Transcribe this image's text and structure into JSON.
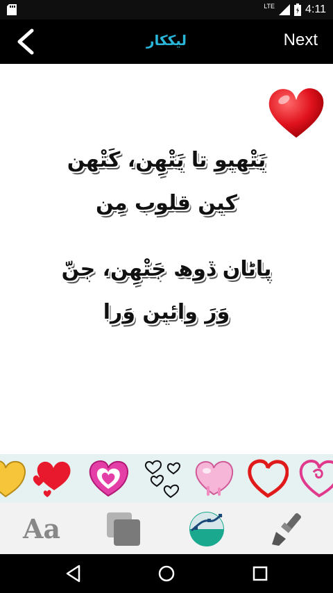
{
  "status": {
    "time": "4:11",
    "network": "LTE"
  },
  "appbar": {
    "title": "ليككار",
    "next_label": "Next"
  },
  "poem": {
    "line1": "يَتْهيو تا يَتْهِن، كَتْهن",
    "line2": "كين قلوب مِن",
    "line3": "پاڻان ڏوھ جَتْهِن، جنّ",
    "line4": "وَرَ وائين وَرا"
  },
  "stickers": [
    "yellow-heart",
    "red-hearts",
    "pink-heart",
    "outline-hearts",
    "pink-drip-heart",
    "red-outline-heart",
    "pink-swirl-heart"
  ],
  "tools": {
    "text_label": "Aa"
  },
  "colors": {
    "title": "#29b6d8",
    "appbar": "#000000",
    "sticker_bar": "#e6f2f2"
  }
}
